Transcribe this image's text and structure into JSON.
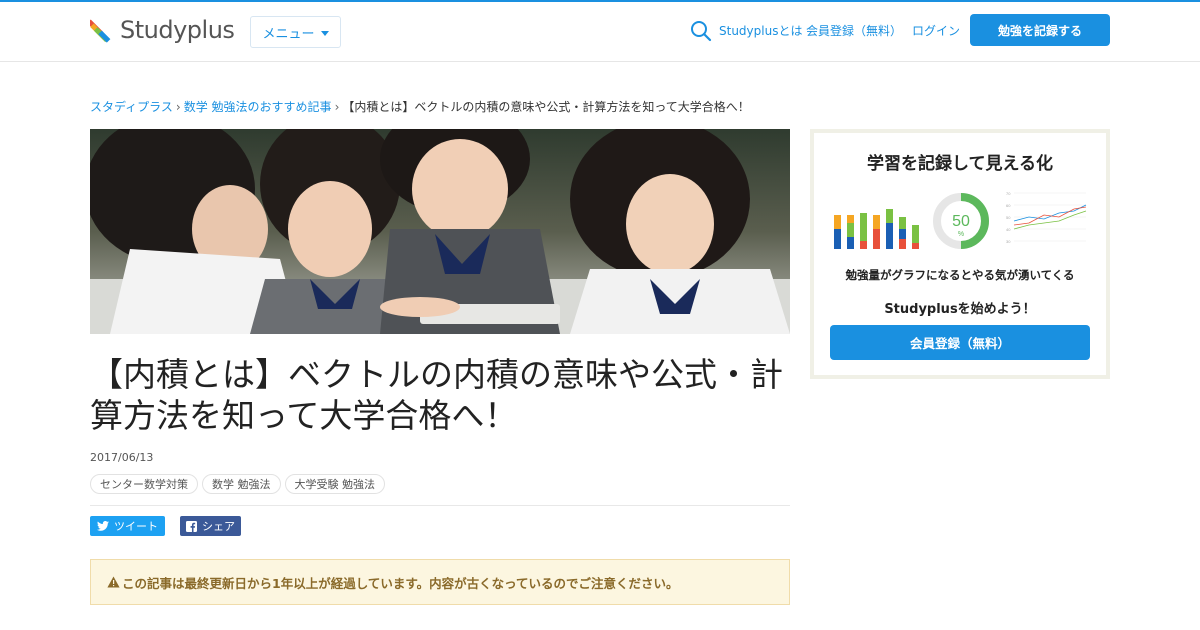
{
  "header": {
    "logo_text": "Studyplus",
    "menu_label": "メニュー",
    "nav": [
      "Studyplusとは",
      "会員登録（無料）",
      "ログイン"
    ],
    "cta_label": "勉強を記録する",
    "accent_color": "#1a90e0"
  },
  "breadcrumb": {
    "items": [
      "スタディプラス",
      "数学 勉強法のおすすめ記事"
    ],
    "current": "【内積とは】ベクトルの内積の意味や公式・計算方法を知って大学合格へ！",
    "separator": "›"
  },
  "article": {
    "title": "【内積とは】ベクトルの内積の意味や公式・計算方法を知って大学合格へ！",
    "date": "2017/06/13",
    "tags": [
      "センター数学対策",
      "数学 勉強法",
      "大学受験 勉強法"
    ],
    "share": {
      "tweet": "ツイート",
      "facebook": "シェア"
    },
    "notice": "この記事は最終更新日から1年以上が経過しています。内容が古くなっているのでご注意ください。"
  },
  "sidebar": {
    "title": "学習を記録して見える化",
    "donut_value": "50",
    "donut_unit": "%",
    "description": "勉強量がグラフになるとやる気が湧いてくる",
    "subtitle": "Studyplusを始めよう！",
    "button_label": "会員登録（無料）",
    "chart_axis_labels": [
      "70",
      "60",
      "50",
      "40",
      "30"
    ]
  },
  "icons": [
    "logo-mark-icon",
    "search-icon",
    "chevron-down-icon",
    "twitter-icon",
    "facebook-icon",
    "warning-icon"
  ]
}
